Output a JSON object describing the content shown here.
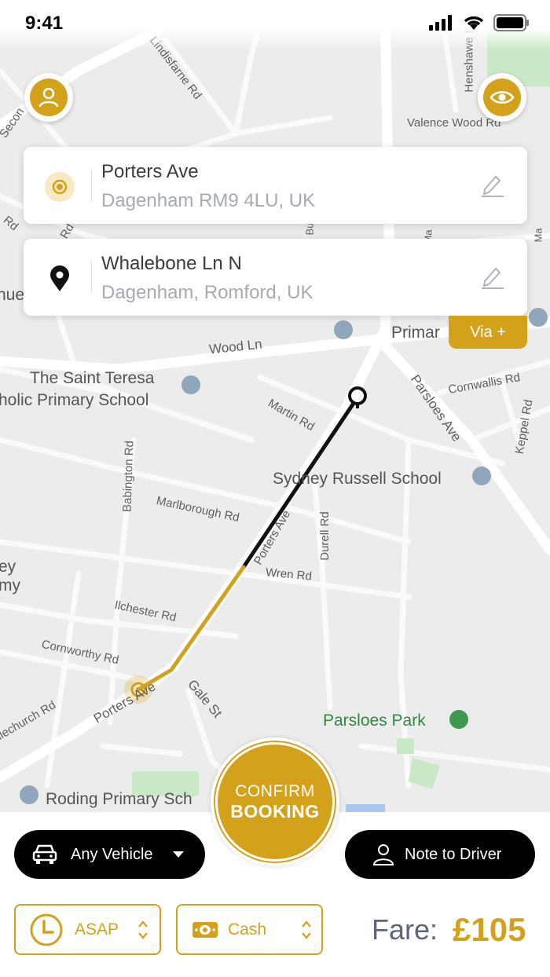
{
  "status_bar": {
    "time": "9:41"
  },
  "map": {
    "streets": [
      "Lindisfarne Rd",
      "Secon",
      "Henshawe Rd",
      "Valence Wood Rd",
      "Wood Ln",
      "Martin Rd",
      "Parsloes Ave",
      "Cornwallis Rd",
      "Keppel Rd",
      "Babington Rd",
      "Marlborough Rd",
      "Porters Ave",
      "Durell Rd",
      "Wren Rd",
      "Ilchester Rd",
      "Cornworthy Rd",
      "Gale St",
      "Illechurch Rd",
      "Porters Ave",
      "nue",
      "Rd",
      "Rd",
      "Bu",
      "Ma",
      "Ma"
    ],
    "places": {
      "school1_line1": "The Saint Teresa",
      "school1_line2": "holic Primary School",
      "school2": "Sydney Russell School",
      "primary": "Primar",
      "park": "Parsloes Park",
      "school3": "Roding Primary Sch",
      "edge1": "ey",
      "edge2": "my"
    }
  },
  "top_buttons": {
    "profile_icon": "user-icon",
    "view_icon": "eye-icon"
  },
  "pickup": {
    "title": "Porters Ave",
    "subtitle": "Dagenham RM9 4LU, UK"
  },
  "dropoff": {
    "title": "Whalebone Ln N",
    "subtitle": "Dagenham, Romford, UK"
  },
  "via_label": "Via +",
  "confirm": {
    "line1": "CONFIRM",
    "line2": "BOOKING"
  },
  "vehicle": {
    "label": "Any Vehicle"
  },
  "note": {
    "label": "Note to Driver"
  },
  "time_select": {
    "value": "ASAP"
  },
  "payment_select": {
    "value": "Cash"
  },
  "fare": {
    "label": "Fare:",
    "value": "£105"
  },
  "colors": {
    "accent": "#d3a21a",
    "text_dark": "#3b3b3b",
    "text_muted": "#a6a9b6"
  }
}
